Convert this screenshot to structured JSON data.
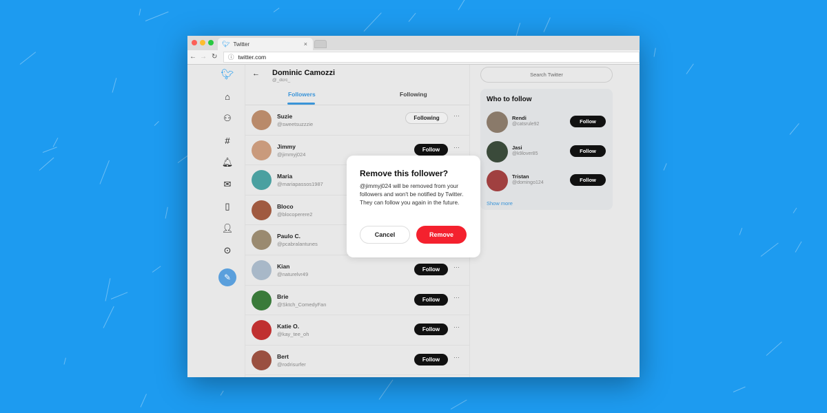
{
  "colors": {
    "background": "#1d9bf0",
    "accent": "#1d9bf0",
    "danger": "#f4212e",
    "follow_button": "#111111"
  },
  "browser": {
    "tab_title": "Twitter",
    "url": "twitter.com",
    "tab_icon": "twitter-bird-icon"
  },
  "sidebar": {
    "icons": [
      "twitter-logo-icon",
      "home-icon",
      "explore-icon",
      "hashtag-icon",
      "bell-icon",
      "mail-icon",
      "bookmark-icon",
      "profile-icon",
      "more-icon"
    ],
    "compose_icon": "compose-icon"
  },
  "profile": {
    "name": "Dominic Camozzi",
    "handle": "@_dcrc_"
  },
  "tabs": [
    {
      "label": "Followers",
      "active": true
    },
    {
      "label": "Following",
      "active": false
    }
  ],
  "followers": [
    {
      "name": "Suzie",
      "handle": "@sweetsuzzzie",
      "button": "Following",
      "color": "#b98a6a"
    },
    {
      "name": "Jimmy",
      "handle": "@jimmyj024",
      "button": "Follow",
      "color": "#c99a7c"
    },
    {
      "name": "Maria",
      "handle": "@mariapassos1987",
      "button": "Follow",
      "color": "#4aa0a0"
    },
    {
      "name": "Bloco",
      "handle": "@blocoperere2",
      "button": "Follow",
      "color": "#a05a40"
    },
    {
      "name": "Paulo C.",
      "handle": "@pcabralantunes",
      "button": "Follow",
      "color": "#9a8a70"
    },
    {
      "name": "Kian",
      "handle": "@naturelvr49",
      "button": "Follow",
      "color": "#a8b8c8"
    },
    {
      "name": "Brie",
      "handle": "@Sktch_ComedyFan",
      "button": "Follow",
      "color": "#3a7a3a"
    },
    {
      "name": "Katie O.",
      "handle": "@kay_tee_oh",
      "button": "Follow",
      "color": "#c03030"
    },
    {
      "name": "Bert",
      "handle": "@rodrisurfer",
      "button": "Follow",
      "color": "#9a5040"
    }
  ],
  "right": {
    "search_placeholder": "Search Twitter",
    "who_to_follow_title": "Who to follow",
    "suggestions": [
      {
        "name": "Rendi",
        "handle": "@catsrule92",
        "button": "Follow",
        "color": "#8a7a6a"
      },
      {
        "name": "Jasi",
        "handle": "@k9lover85",
        "button": "Follow",
        "color": "#3a4a3a"
      },
      {
        "name": "Tristan",
        "handle": "@domingo124",
        "button": "Follow",
        "color": "#a04040"
      }
    ],
    "show_more": "Show more"
  },
  "modal": {
    "title": "Remove this follower?",
    "body": "@jimmyj024 will be removed from your followers and won't be notified by Twitter. They can follow you again in the future.",
    "cancel": "Cancel",
    "remove": "Remove"
  }
}
